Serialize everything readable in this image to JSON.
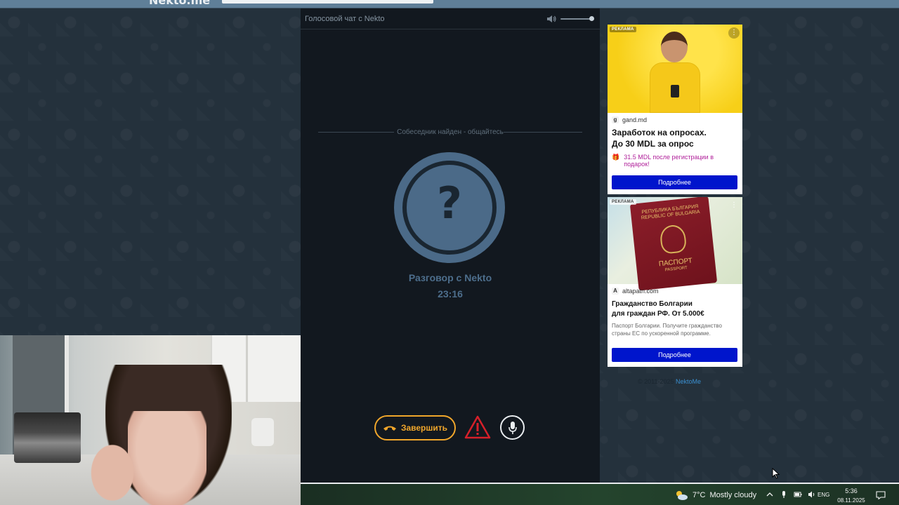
{
  "browser": {
    "site_name": "Nekto.me"
  },
  "chat": {
    "header_title": "Голосовой чат с Nekto",
    "status_text": "Собеседник найден - общайтесь",
    "partner_name": "Разговор с Nekto",
    "timer": "23:16",
    "end_button_label": "Завершить",
    "volume_level": 1.0
  },
  "ads": [
    {
      "label": "РЕКЛАМА",
      "domain": "gand.md",
      "domain_icon": "g",
      "headline_line1": "Заработок на опросах.",
      "headline_line2": "До 30 MDL за опрос",
      "promo": "31.5 MDL после регистрации в подарок!",
      "cta": "Подробнее"
    },
    {
      "label": "РЕКЛАМА",
      "domain": "altapatri.com",
      "domain_icon": "A",
      "headline_line1": "Гражданство Болгарии",
      "headline_line2": "для граждан РФ. От 5.000€",
      "body": "Паспорт Болгарии. Получите гражданство страны ЕС по ускоренной программе.",
      "cta": "Подробнее",
      "passport_top": "РЕПУБЛИКА БЪЛГАРИЯ",
      "passport_top2": "REPUBLIC OF BULGARIA",
      "passport_title": "ПАСПОРТ",
      "passport_sub": "PASSPORT"
    }
  ],
  "footer": {
    "copyright": "© 2011-2025",
    "link": "NektoMe"
  },
  "taskbar": {
    "weather_temp": "7°C",
    "weather_text": "Mostly cloudy",
    "language": "ENG",
    "time": "5:36",
    "date": "08.11.2025"
  },
  "colors": {
    "accent_orange": "#f0a62b",
    "avatar_blue": "#4b6a88",
    "ad_cta_blue": "#0015cc",
    "chat_bg": "#12181f"
  }
}
